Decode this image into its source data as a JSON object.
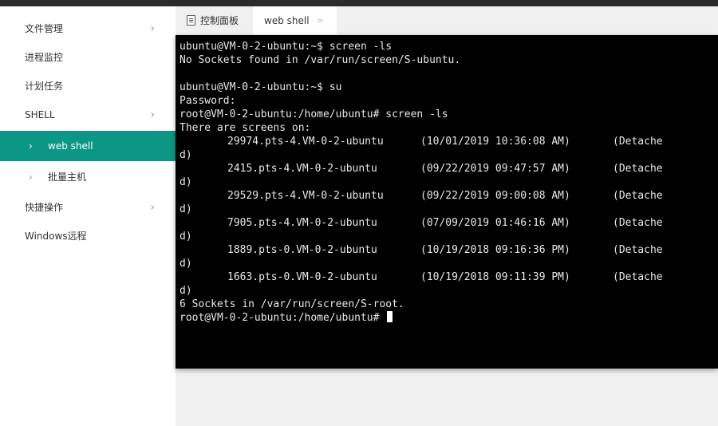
{
  "sidebar": {
    "items": [
      {
        "label": "文件管理"
      },
      {
        "label": "进程监控"
      },
      {
        "label": "计划任务"
      },
      {
        "label": "SHELL"
      },
      {
        "label": "web shell"
      },
      {
        "label": "批量主机"
      },
      {
        "label": "快捷操作"
      },
      {
        "label": "Windows远程"
      }
    ]
  },
  "tabs": [
    {
      "label": "控制面板"
    },
    {
      "label": "web shell"
    }
  ],
  "terminal": {
    "lines_before": [
      "ubuntu@VM-0-2-ubuntu:~$ screen -ls",
      "No Sockets found in /var/run/screen/S-ubuntu.",
      "",
      "ubuntu@VM-0-2-ubuntu:~$ su",
      "Password:",
      "root@VM-0-2-ubuntu:/home/ubuntu# screen -ls",
      "There are screens on:"
    ],
    "screens": [
      {
        "name": "29974.pts-4.VM-0-2-ubuntu",
        "time": "(10/01/2019 10:36:08 AM)",
        "status": "(Detache",
        "wrap": "d)"
      },
      {
        "name": "2415.pts-4.VM-0-2-ubuntu",
        "time": "(09/22/2019 09:47:57 AM)",
        "status": "(Detache",
        "wrap": "d)"
      },
      {
        "name": "29529.pts-4.VM-0-2-ubuntu",
        "time": "(09/22/2019 09:00:08 AM)",
        "status": "(Detache",
        "wrap": "d)"
      },
      {
        "name": "7905.pts-4.VM-0-2-ubuntu",
        "time": "(07/09/2019 01:46:16 AM)",
        "status": "(Detache",
        "wrap": "d)"
      },
      {
        "name": "1889.pts-0.VM-0-2-ubuntu",
        "time": "(10/19/2018 09:16:36 PM)",
        "status": "(Detache",
        "wrap": "d)"
      },
      {
        "name": "1663.pts-0.VM-0-2-ubuntu",
        "time": "(10/19/2018 09:11:39 PM)",
        "status": "(Detache",
        "wrap": "d)"
      }
    ],
    "summary": "6 Sockets in /var/run/screen/S-root.",
    "prompt": "root@VM-0-2-ubuntu:/home/ubuntu# "
  }
}
